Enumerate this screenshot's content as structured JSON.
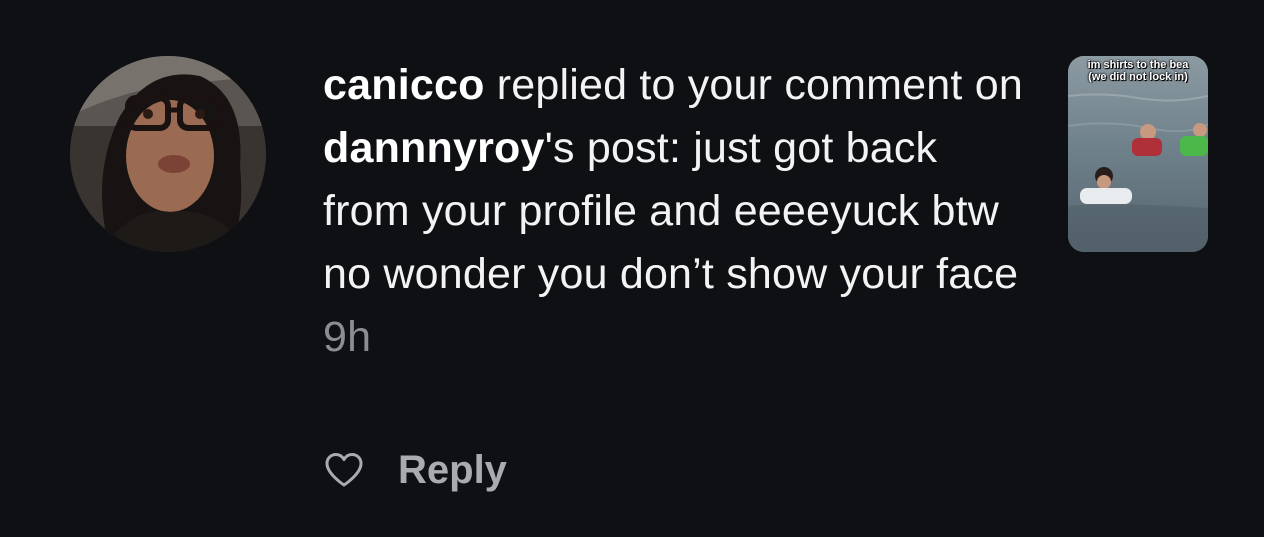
{
  "notification": {
    "username": "canicco",
    "action_text_1": " replied to your comment on ",
    "post_owner": "dannnyroy",
    "action_text_2": "'s post: just got back from your profile and eeeeyuck btw no wonder you don’t show your face",
    "timestamp": "9h",
    "reply_label": "Reply",
    "like_icon": "heart-outline-icon",
    "thumbnail": {
      "caption_line_1": "im shirts to the bea",
      "caption_line_2": "(we did not lock in)"
    }
  },
  "colors": {
    "background": "#0e1014",
    "text": "#f3f3f3",
    "muted": "#8b8d92",
    "reply": "#a9abb1"
  }
}
